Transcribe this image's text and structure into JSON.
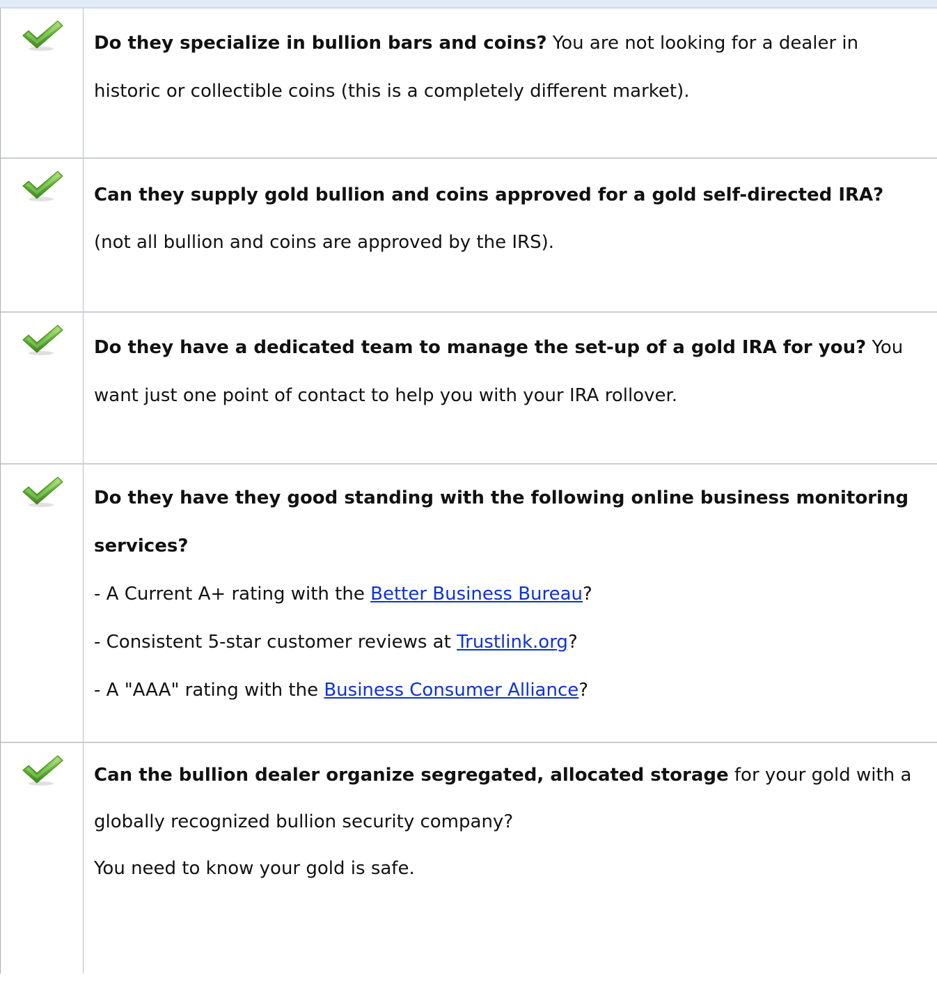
{
  "colors": {
    "top_band": "#dfeaf6",
    "link": "#0b33d6",
    "check_green": "#5cb12e"
  },
  "icon_name": "checkmark-icon",
  "rows": [
    {
      "bold": "Do they specialize in bullion bars and coins?",
      "text": " You are not looking for a dealer in historic or collectible coins (this is a completely different market)."
    },
    {
      "bold": "Can they supply gold bullion and coins approved for a gold self-directed IRA?",
      "text": " (not all bullion and coins are approved by the IRS)."
    },
    {
      "bold": "Do they have a dedicated team to manage the set-up of a gold IRA for you?",
      "text": " You want just one point of contact to help you with your IRA rollover."
    },
    {
      "bold": "Do they have they good standing with the following online business monitoring services?",
      "items": [
        {
          "prefix": "- A Current A+ rating with the ",
          "link": "Better Business Bureau",
          "suffix": "?"
        },
        {
          "prefix": "- Consistent 5-star customer reviews at ",
          "link": "Trustlink.org",
          "suffix": "?"
        },
        {
          "prefix": "- A \"AAA\" rating with the ",
          "link": "Business Consumer Alliance",
          "suffix": "?"
        }
      ]
    },
    {
      "bold": "Can the bullion dealer organize segregated, allocated storage",
      "text": " for your gold with a globally recognized bullion security company?",
      "text2": "You need to know your gold is safe."
    }
  ]
}
